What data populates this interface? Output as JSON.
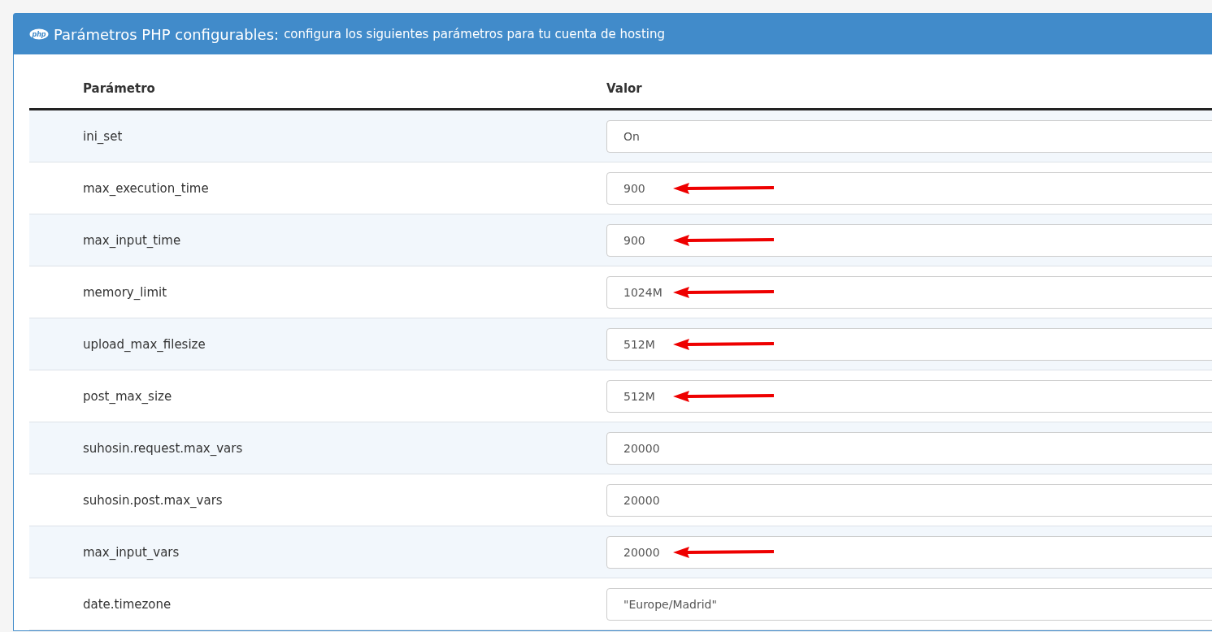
{
  "panel": {
    "icon_text": "php",
    "title": "Parámetros PHP configurables:",
    "subtitle": "configura los siguientes parámetros para tu cuenta de hosting"
  },
  "table": {
    "columns": [
      "Parámetro",
      "Valor"
    ],
    "rows": [
      {
        "parameter": "ini_set",
        "value": "On",
        "marked": false
      },
      {
        "parameter": "max_execution_time",
        "value": "900",
        "marked": true
      },
      {
        "parameter": "max_input_time",
        "value": "900",
        "marked": true
      },
      {
        "parameter": "memory_limit",
        "value": "1024M",
        "marked": true
      },
      {
        "parameter": "upload_max_filesize",
        "value": "512M",
        "marked": true
      },
      {
        "parameter": "post_max_size",
        "value": "512M",
        "marked": true
      },
      {
        "parameter": "suhosin.request.max_vars",
        "value": "20000",
        "marked": false
      },
      {
        "parameter": "suhosin.post.max_vars",
        "value": "20000",
        "marked": false
      },
      {
        "parameter": "max_input_vars",
        "value": "20000",
        "marked": true
      },
      {
        "parameter": "date.timezone",
        "value": "\"Europe/Madrid\"",
        "marked": false
      }
    ]
  }
}
